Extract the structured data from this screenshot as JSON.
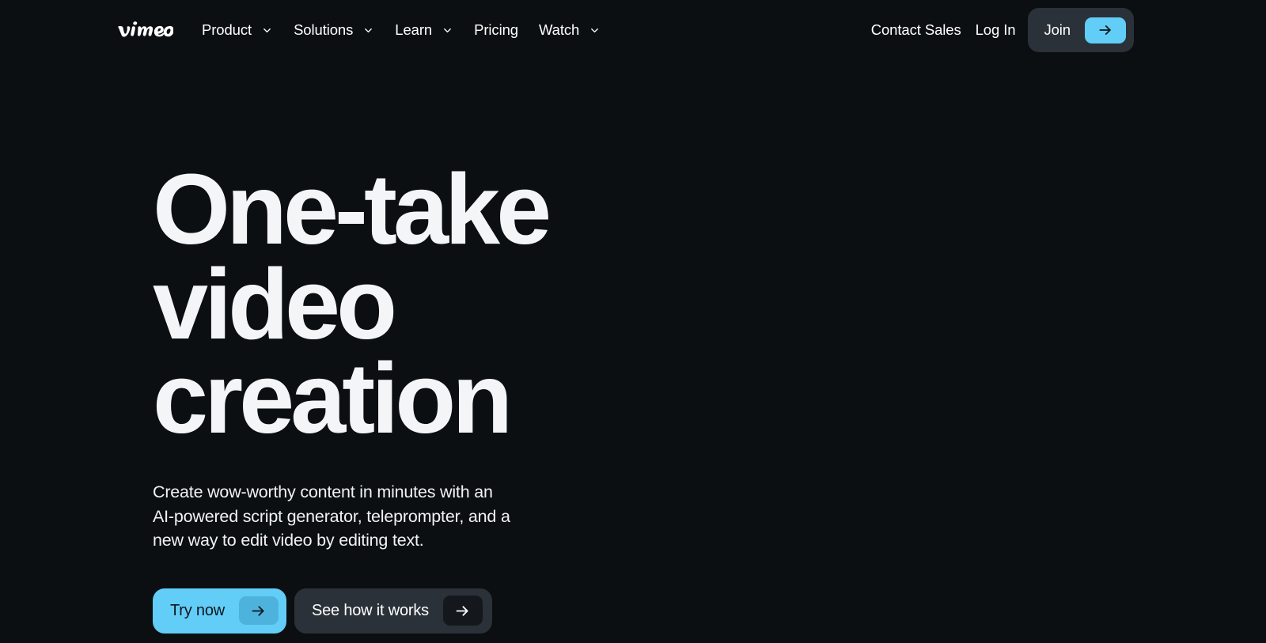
{
  "page": {
    "background_color": "#0c0f12",
    "accent_color": "#62cdf7",
    "surface_color": "#2b3138"
  },
  "header": {
    "logo": {
      "name": "vimeo",
      "icon": "vimeo-wordmark"
    },
    "nav_items": [
      {
        "label": "Product",
        "has_dropdown": true,
        "icon": "chevron-down-icon"
      },
      {
        "label": "Solutions",
        "has_dropdown": true,
        "icon": "chevron-down-icon"
      },
      {
        "label": "Learn",
        "has_dropdown": true,
        "icon": "chevron-down-icon"
      },
      {
        "label": "Pricing",
        "has_dropdown": false,
        "icon": ""
      },
      {
        "label": "Watch",
        "has_dropdown": true,
        "icon": "chevron-down-icon"
      }
    ],
    "contact_sales_label": "Contact Sales",
    "log_in_label": "Log In",
    "join": {
      "label": "Join",
      "icon": "arrow-right-icon",
      "arrow_color": "#62cdf7"
    }
  },
  "hero": {
    "title": "One-take video creation",
    "subtitle": "Create wow-worthy content in minutes with an AI-powered script generator, teleprompter, and a new way to edit video by editing text.",
    "primary_cta": {
      "label": "Try now",
      "icon": "arrow-right-icon",
      "background": "#62cdf7"
    },
    "secondary_cta": {
      "label": "See how it works",
      "icon": "arrow-right-icon",
      "background": "#2b3138"
    }
  }
}
